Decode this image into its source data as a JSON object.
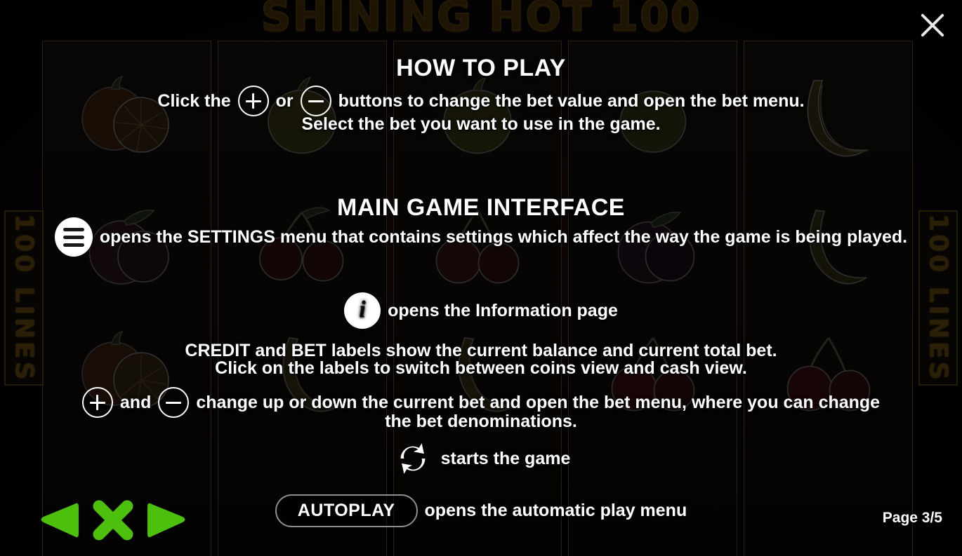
{
  "window": {
    "game_title": "SHINING HOT 100",
    "close_label": "close-icon"
  },
  "side_panels": {
    "left_text": "100 LINES",
    "right_text": "100 LINES"
  },
  "how_to_play": {
    "title": "HOW TO PLAY",
    "line1_part1": "Click the",
    "plus_icon": "plus-circle-icon",
    "or": "or",
    "minus_icon": "minus-circle-icon",
    "line1_part2": "buttons to change the bet value and open the bet menu.",
    "line2": "Select the bet you want to use in the game."
  },
  "main_game_interface": {
    "title": "MAIN GAME INTERFACE",
    "settings": {
      "icon": "hamburger-menu-icon",
      "text": "opens the SETTINGS menu that contains settings which affect the way the game is being played."
    },
    "info": {
      "icon": "info-icon",
      "text": "opens the Information page"
    },
    "credit_bet": {
      "line1": "CREDIT and BET labels show the current balance and current total bet.",
      "line2": "Click on the labels to switch between coins view and cash view."
    },
    "bet_controls": {
      "plus_icon": "plus-circle-icon",
      "and": "and",
      "minus_icon": "minus-circle-icon",
      "text_line1": "change up or down the current bet and open the bet menu, where you can change",
      "text_line2": "the bet denominations."
    },
    "spin": {
      "icon": "refresh-spin-icon",
      "text": "starts the game"
    },
    "autoplay": {
      "button_label": "AUTOPLAY",
      "text": "opens the automatic play menu"
    }
  },
  "footer": {
    "prev_label": "previous-page",
    "close_label": "close-help",
    "next_label": "next-page",
    "page_indicator": "Page 3/5"
  },
  "colors": {
    "accent_green": "#4DBF0D",
    "text_white": "#FFFFFF",
    "background": "#050305",
    "reel_border": "#2A2106",
    "logo_gold": "#2B2007"
  }
}
